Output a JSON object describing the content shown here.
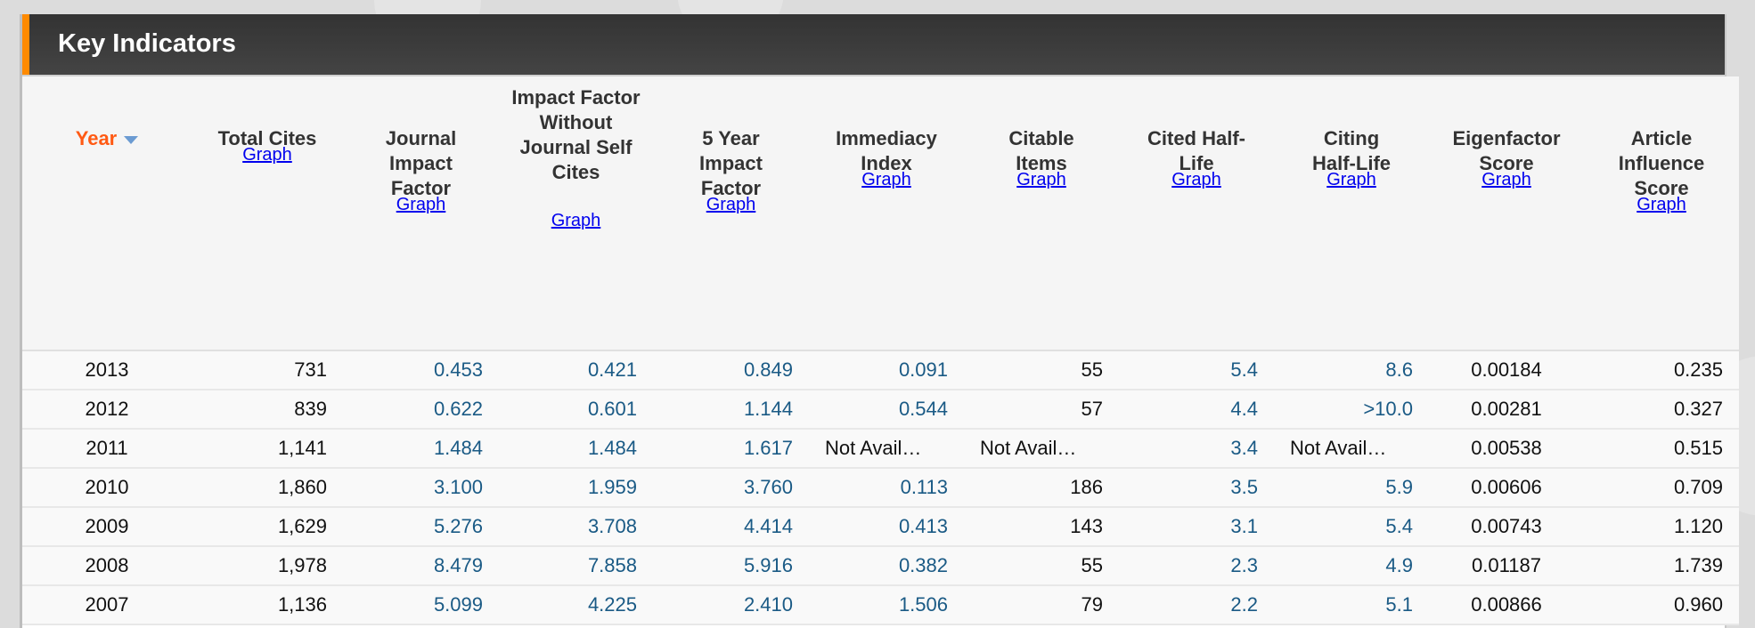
{
  "panel": {
    "title": "Key Indicators"
  },
  "colors": {
    "accent": "#ff8a00",
    "sort_header": "#ff5a14",
    "link": "#0000ee",
    "metric_value": "#1a5a85"
  },
  "columns": [
    {
      "key": "year",
      "label": "Year",
      "sorted": "descending",
      "graph": null
    },
    {
      "key": "total_cites",
      "label": "Total Cites",
      "graph": "Graph"
    },
    {
      "key": "jif",
      "label": "Journal Impact Factor",
      "graph": "Graph"
    },
    {
      "key": "jif_no_self",
      "label": "Impact Factor Without Journal Self Cites",
      "graph": "Graph"
    },
    {
      "key": "five_year",
      "label": "5 Year Impact Factor",
      "graph": "Graph"
    },
    {
      "key": "immediacy",
      "label": "Immediacy Index",
      "graph": "Graph"
    },
    {
      "key": "citable",
      "label": "Citable Items",
      "graph": "Graph"
    },
    {
      "key": "cited_hl",
      "label": "Cited Half-Life",
      "graph": "Graph"
    },
    {
      "key": "citing_hl",
      "label": "Citing Half-Life",
      "graph": "Graph"
    },
    {
      "key": "eigen",
      "label": "Eigenfactor Score",
      "graph": "Graph"
    },
    {
      "key": "ais",
      "label": "Article Influence Score",
      "graph": "Graph"
    }
  ],
  "rows": [
    [
      "2013",
      "731",
      "0.453",
      "0.421",
      "0.849",
      "0.091",
      "55",
      "5.4",
      "8.6",
      "0.00184",
      "0.235"
    ],
    [
      "2012",
      "839",
      "0.622",
      "0.601",
      "1.144",
      "0.544",
      "57",
      "4.4",
      ">10.0",
      "0.00281",
      "0.327"
    ],
    [
      "2011",
      "1,141",
      "1.484",
      "1.484",
      "1.617",
      "Not Avail…",
      "Not Avail…",
      "3.4",
      "Not Avail…",
      "0.00538",
      "0.515"
    ],
    [
      "2010",
      "1,860",
      "3.100",
      "1.959",
      "3.760",
      "0.113",
      "186",
      "3.5",
      "5.9",
      "0.00606",
      "0.709"
    ],
    [
      "2009",
      "1,629",
      "5.276",
      "3.708",
      "4.414",
      "0.413",
      "143",
      "3.1",
      "5.4",
      "0.00743",
      "1.120"
    ],
    [
      "2008",
      "1,978",
      "8.479",
      "7.858",
      "5.916",
      "0.382",
      "55",
      "2.3",
      "4.9",
      "0.01187",
      "1.739"
    ],
    [
      "2007",
      "1,136",
      "5.099",
      "4.225",
      "2.410",
      "1.506",
      "79",
      "2.2",
      "5.1",
      "0.00866",
      "0.960"
    ]
  ]
}
